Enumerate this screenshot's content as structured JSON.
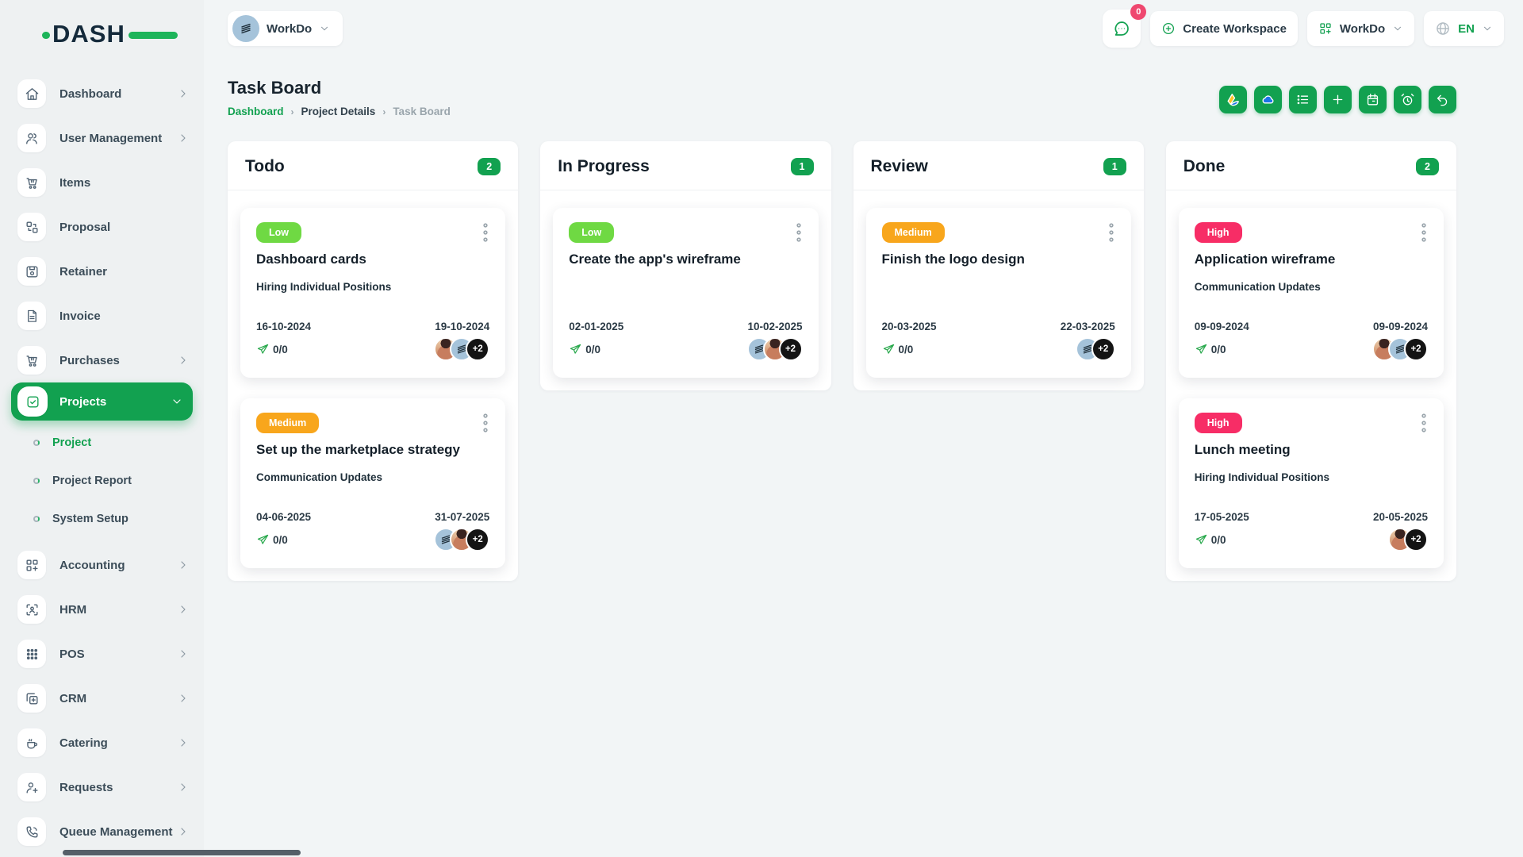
{
  "brand": {
    "name": "DASH"
  },
  "theme": {
    "primary_green": "#12a150",
    "logo_green": "#1db45a",
    "low_green": "#6fd943",
    "medium_orange": "#f8a61c",
    "high_pink": "#f72d66",
    "badge_pink": "#ef486f",
    "avatar_blue": "#a5c3da"
  },
  "topbar": {
    "workspace": {
      "label": "WorkDo"
    },
    "chat": {
      "badge": "0"
    },
    "create_workspace": {
      "label": "Create Workspace"
    },
    "app_menu": {
      "label": "WorkDo"
    },
    "language": {
      "label": "EN"
    }
  },
  "page": {
    "title": "Task Board",
    "breadcrumb": [
      {
        "label": "Dashboard",
        "type": "link"
      },
      {
        "label": "Project Details",
        "type": "mid"
      },
      {
        "label": "Task Board",
        "type": "current"
      }
    ]
  },
  "toolbar": {
    "buttons": [
      {
        "name": "google-drive-button",
        "icon": "google-drive"
      },
      {
        "name": "one-drive-button",
        "icon": "one-drive"
      },
      {
        "name": "list-view-button",
        "icon": "list"
      },
      {
        "name": "add-task-button",
        "icon": "plus"
      },
      {
        "name": "calendar-button",
        "icon": "calendar"
      },
      {
        "name": "timer-button",
        "icon": "alarm"
      },
      {
        "name": "back-button",
        "icon": "undo"
      }
    ]
  },
  "sidebar": {
    "items": [
      {
        "label": "Dashboard",
        "icon": "home",
        "chevron": true
      },
      {
        "label": "User Management",
        "icon": "users",
        "chevron": true
      },
      {
        "label": "Items",
        "icon": "cart",
        "chevron": false
      },
      {
        "label": "Proposal",
        "icon": "swap",
        "chevron": false
      },
      {
        "label": "Retainer",
        "icon": "save",
        "chevron": false
      },
      {
        "label": "Invoice",
        "icon": "file",
        "chevron": false
      },
      {
        "label": "Purchases",
        "icon": "cart",
        "chevron": true
      },
      {
        "label": "Projects",
        "icon": "check-square",
        "chevron": true,
        "active": true,
        "expanded": true,
        "children": [
          {
            "label": "Project",
            "active": true
          },
          {
            "label": "Project Report",
            "active": false
          },
          {
            "label": "System Setup",
            "active": false
          }
        ]
      },
      {
        "label": "Accounting",
        "icon": "grid-plus",
        "chevron": true
      },
      {
        "label": "HRM",
        "icon": "scan-user",
        "chevron": true
      },
      {
        "label": "POS",
        "icon": "grid-dots",
        "chevron": true
      },
      {
        "label": "CRM",
        "icon": "copy",
        "chevron": true
      },
      {
        "label": "Catering",
        "icon": "coffee",
        "chevron": true
      },
      {
        "label": "Requests",
        "icon": "user-plus",
        "chevron": true
      },
      {
        "label": "Queue Management",
        "icon": "phone",
        "chevron": true
      }
    ]
  },
  "board": {
    "columns": [
      {
        "title": "Todo",
        "count": "2",
        "cards": [
          {
            "priority": "Low",
            "priority_color": "#6fd943",
            "title": "Dashboard cards",
            "subtitle": "Hiring Individual Positions",
            "start_date": "16-10-2024",
            "end_date": "19-10-2024",
            "progress": "0/0",
            "avatars": [
              "photo",
              "logo",
              "more"
            ],
            "more_label": "+2"
          },
          {
            "priority": "Medium",
            "priority_color": "#f8a61c",
            "title": "Set up the marketplace strategy",
            "subtitle": "Communication Updates",
            "start_date": "04-06-2025",
            "end_date": "31-07-2025",
            "progress": "0/0",
            "avatars": [
              "logo",
              "photo",
              "more"
            ],
            "more_label": "+2"
          }
        ]
      },
      {
        "title": "In Progress",
        "count": "1",
        "cards": [
          {
            "priority": "Low",
            "priority_color": "#6fd943",
            "title": "Create the app's wireframe",
            "subtitle": "",
            "start_date": "02-01-2025",
            "end_date": "10-02-2025",
            "progress": "0/0",
            "avatars": [
              "logo",
              "photo",
              "more"
            ],
            "more_label": "+2"
          }
        ]
      },
      {
        "title": "Review",
        "count": "1",
        "cards": [
          {
            "priority": "Medium",
            "priority_color": "#f8a61c",
            "title": "Finish the logo design",
            "subtitle": "",
            "start_date": "20-03-2025",
            "end_date": "22-03-2025",
            "progress": "0/0",
            "avatars": [
              "logo",
              "more"
            ],
            "more_label": "+2"
          }
        ]
      },
      {
        "title": "Done",
        "count": "2",
        "cards": [
          {
            "priority": "High",
            "priority_color": "#f72d66",
            "title": "Application wireframe",
            "subtitle": "Communication Updates",
            "start_date": "09-09-2024",
            "end_date": "09-09-2024",
            "progress": "0/0",
            "avatars": [
              "photo",
              "logo",
              "more"
            ],
            "more_label": "+2"
          },
          {
            "priority": "High",
            "priority_color": "#f72d66",
            "title": "Lunch meeting",
            "subtitle": "Hiring Individual Positions",
            "start_date": "17-05-2025",
            "end_date": "20-05-2025",
            "progress": "0/0",
            "avatars": [
              "photo",
              "more"
            ],
            "more_label": "+2"
          }
        ]
      }
    ]
  }
}
